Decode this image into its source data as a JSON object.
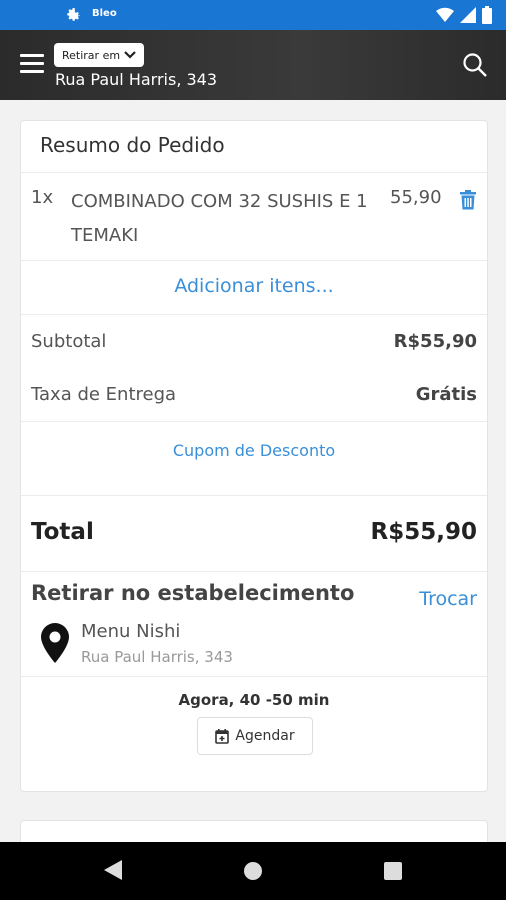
{
  "status_bar": {
    "app_label": "Bleo"
  },
  "header": {
    "pickup_dropdown": "Retirar em",
    "address": "Rua Paul Harris, 343"
  },
  "order": {
    "title": "Resumo do Pedido",
    "item": {
      "qty": "1x",
      "name": "COMBINADO COM 32 SUSHIS E 1 TEMAKI",
      "price": "55,90"
    },
    "add_items": "Adicionar itens...",
    "subtotal_label": "Subtotal",
    "subtotal_value": "R$55,90",
    "delivery_label": "Taxa de Entrega",
    "delivery_value": "Grátis",
    "coupon": "Cupom de Desconto",
    "total_label": "Total",
    "total_value": "R$55,90"
  },
  "pickup": {
    "title": "Retirar no estabelecimento",
    "change": "Trocar",
    "store_name": "Menu Nishi",
    "store_address": "Rua Paul Harris, 343",
    "time": "Agora, 40 -50 min",
    "schedule": "Agendar"
  },
  "colors": {
    "accent": "#3a8fd8",
    "status_bar": "#1976d2",
    "app_bar": "#2f2f2f"
  },
  "icons": [
    "gear-icon",
    "wifi-icon",
    "signal-icon",
    "battery-icon",
    "menu-icon",
    "chevron-down-icon",
    "search-icon",
    "trash-icon",
    "location-pin-icon",
    "calendar-icon",
    "back-icon",
    "home-icon",
    "recent-apps-icon"
  ]
}
